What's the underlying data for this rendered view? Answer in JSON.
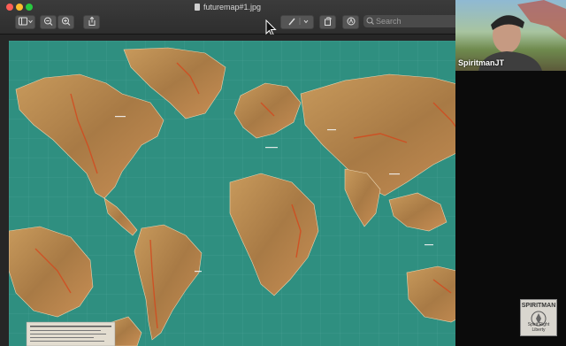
{
  "window": {
    "title": "futuremap#1.jpg"
  },
  "toolbar": {
    "search_placeholder": "Search"
  },
  "webcam": {
    "name_label": "SpiritmanJT"
  },
  "logo": {
    "word": "SPIRITMAN",
    "tagline": "Spirit Right Liberty"
  },
  "colors": {
    "ocean": "#2f8f80",
    "land": "#b8894f",
    "relief": "#d24a1e",
    "window_chrome": "#333333"
  },
  "icons": {
    "sidebar_toggle": "sidebar-icon",
    "zoom_out": "zoom-out-icon",
    "zoom_in": "zoom-in-icon",
    "share": "share-icon",
    "markup": "pen-icon",
    "rotate": "rotate-icon",
    "annotate": "markup-circle-icon",
    "search": "search-icon"
  }
}
